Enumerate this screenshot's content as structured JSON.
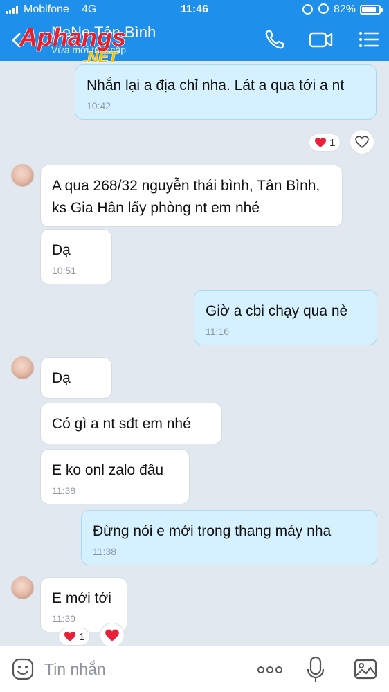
{
  "status_bar": {
    "carrier": "Mobifone",
    "network": "4G",
    "time": "11:46",
    "battery_percent": "82%",
    "battery_level": 0.82
  },
  "header": {
    "contact_name": "NeNe Tân Bình",
    "contact_status": "Vừa mới truy cập",
    "watermark_text": "Aphangs",
    "watermark_suffix": ".NET",
    "icons": [
      "back-icon",
      "phone-icon",
      "video-call-icon",
      "menu-icon"
    ]
  },
  "messages": [
    {
      "direction": "out",
      "text": "Nhắn lại a địa chỉ nha. Lát a qua tới a nt",
      "time": "10:42",
      "reaction": {
        "emoji": "heart",
        "count": "1"
      }
    },
    {
      "direction": "in",
      "text": "A qua 268/32 nguyễn thái bình, Tân Bình, ks Gia Hân lấy phòng nt em nhé",
      "time": ""
    },
    {
      "direction": "in",
      "text": "Dạ",
      "time": "10:51"
    },
    {
      "direction": "out",
      "text": "Giờ a cbi chạy qua nè",
      "time": "11:16"
    },
    {
      "direction": "in",
      "text": "Dạ",
      "time": ""
    },
    {
      "direction": "in",
      "text": "Có gì a nt sđt em nhé",
      "time": ""
    },
    {
      "direction": "in",
      "text": "E ko onl zalo đâu",
      "time": "11:38"
    },
    {
      "direction": "out",
      "text": "Đừng nói e mới trong thang máy nha",
      "time": "11:38"
    },
    {
      "direction": "in",
      "text": "E mới tới",
      "time": "11:39",
      "reaction": {
        "emoji": "heart",
        "count": "1"
      }
    }
  ],
  "input_bar": {
    "placeholder": "Tin nhắn",
    "icons": [
      "emoji-icon",
      "more-icon",
      "microphone-icon",
      "image-icon"
    ]
  },
  "colors": {
    "header_bg": "#1f8fec",
    "chat_bg": "#e2e8ef",
    "outgoing_bubble": "#d5f1ff",
    "incoming_bubble": "#ffffff",
    "heart": "#e8203a"
  }
}
